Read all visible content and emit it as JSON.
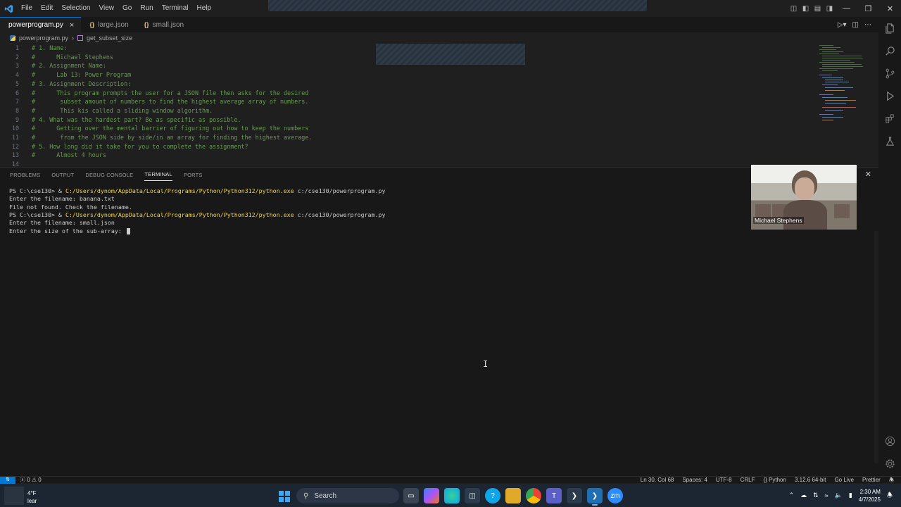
{
  "titlebar": {
    "menu": [
      "File",
      "Edit",
      "Selection",
      "View",
      "Go",
      "Run",
      "Terminal",
      "Help"
    ]
  },
  "tabs": [
    {
      "label": "powerprogram.py",
      "icon": "python-file-icon",
      "active": true
    },
    {
      "label": "large.json",
      "icon": "json-braces-icon",
      "active": false
    },
    {
      "label": "small.json",
      "icon": "json-braces-icon",
      "active": false
    }
  ],
  "breadcrumb": {
    "file": "powerprogram.py",
    "symbol": "get_subset_size"
  },
  "editor": {
    "lines": [
      {
        "n": "1",
        "text": "# 1. Name:"
      },
      {
        "n": "2",
        "text": "#      Michael Stephens"
      },
      {
        "n": "3",
        "text": "# 2. Assignment Name:"
      },
      {
        "n": "4",
        "text": "#      Lab 13: Power Program"
      },
      {
        "n": "5",
        "text": "# 3. Assignment Description:"
      },
      {
        "n": "6",
        "text": "#      This program prompts the user for a JSON file then asks for the desired"
      },
      {
        "n": "7",
        "text": "#       subset amount of numbers to find the highest average array of numbers."
      },
      {
        "n": "8",
        "text": "#       This kis called a sliding window algorithm."
      },
      {
        "n": "9",
        "text": "# 4. What was the hardest part? Be as specific as possible."
      },
      {
        "n": "10",
        "text": "#      Getting over the mental barrier of figuring out how to keep the numbers"
      },
      {
        "n": "11",
        "text": "#       from the JSON side by side/in an array for finding the highest average."
      },
      {
        "n": "12",
        "text": "# 5. How long did it take for you to complete the assignment?"
      },
      {
        "n": "13",
        "text": "#      Almost 4 hours"
      },
      {
        "n": "14",
        "text": ""
      }
    ]
  },
  "panel": {
    "tabs": [
      "PROBLEMS",
      "OUTPUT",
      "DEBUG CONSOLE",
      "TERMINAL",
      "PORTS"
    ],
    "active_tab": "TERMINAL",
    "terminal": [
      {
        "prompt": "PS C:\\cse130> & ",
        "path": "C:/Users/dynom/AppData/Local/Programs/Python/Python312/python.exe",
        "rest": " c:/cse130/powerprogram.py"
      },
      {
        "prompt": "Enter the filename: banana.txt",
        "path": "",
        "rest": ""
      },
      {
        "prompt": "File not found. Check the filename.",
        "path": "",
        "rest": ""
      },
      {
        "prompt": "PS C:\\cse130> & ",
        "path": "C:/Users/dynom/AppData/Local/Programs/Python/Python312/python.exe",
        "rest": " c:/cse130/powerprogram.py"
      },
      {
        "prompt": "Enter the filename: small.json",
        "path": "",
        "rest": ""
      },
      {
        "prompt": "Enter the size of the sub-array: ",
        "path": "",
        "rest": ""
      }
    ]
  },
  "webcam": {
    "name": "Michael Stephens"
  },
  "statusbar": {
    "problems": "ⓧ 0 ⚠ 0",
    "position": "Ln 30, Col 68",
    "spaces": "Spaces: 4",
    "encoding": "UTF-8",
    "eol": "CRLF",
    "language": "{} Python",
    "interpreter": "3.12.6 64-bit",
    "golive": "Go Live",
    "prettier": "Prettier"
  },
  "taskbar": {
    "weather_temp": "4°F",
    "weather_cond": "lear",
    "search_label": "Search",
    "time": "2:30 AM",
    "date": "4/7/2025"
  },
  "colors": {
    "accent": "#0078d4",
    "comment": "#6a9955",
    "path": "#f1d54b"
  }
}
